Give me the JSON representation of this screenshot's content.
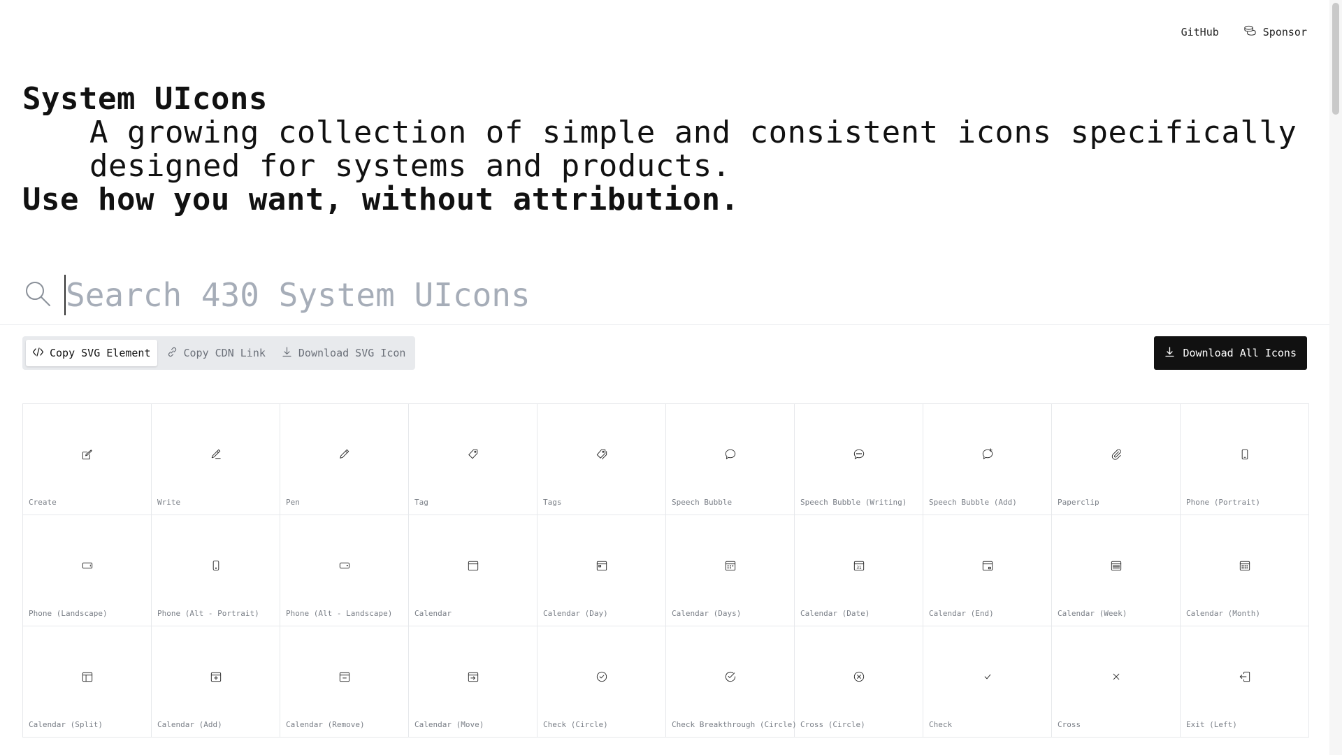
{
  "nav": {
    "github": "GitHub",
    "sponsor": "Sponsor",
    "sponsor_icon": "coins-icon"
  },
  "hero": {
    "title": "System UIcons",
    "subtitle": "A growing collection of simple and consistent icons specifically designed for systems and products.",
    "usage": "Use how you want, without attribution."
  },
  "search": {
    "placeholder": "Search 430 System UIcons",
    "value": ""
  },
  "toolbar": {
    "copy_svg": "Copy SVG Element",
    "copy_cdn": "Copy CDN Link",
    "download_svg": "Download SVG Icon",
    "active": "copy_svg"
  },
  "download_all": "Download All Icons",
  "icons": [
    {
      "label": "Create",
      "icon": "create-icon"
    },
    {
      "label": "Write",
      "icon": "write-icon"
    },
    {
      "label": "Pen",
      "icon": "pen-icon"
    },
    {
      "label": "Tag",
      "icon": "tag-icon"
    },
    {
      "label": "Tags",
      "icon": "tags-icon"
    },
    {
      "label": "Speech Bubble",
      "icon": "speech-bubble-icon"
    },
    {
      "label": "Speech Bubble (Writing)",
      "icon": "speech-bubble-writing-icon"
    },
    {
      "label": "Speech Bubble (Add)",
      "icon": "speech-bubble-add-icon"
    },
    {
      "label": "Paperclip",
      "icon": "paperclip-icon"
    },
    {
      "label": "Phone (Portrait)",
      "icon": "phone-portrait-icon"
    },
    {
      "label": "Phone (Landscape)",
      "icon": "phone-landscape-icon"
    },
    {
      "label": "Phone (Alt - Portrait)",
      "icon": "phone-alt-portrait-icon"
    },
    {
      "label": "Phone (Alt - Landscape)",
      "icon": "phone-alt-landscape-icon"
    },
    {
      "label": "Calendar",
      "icon": "calendar-icon"
    },
    {
      "label": "Calendar (Day)",
      "icon": "calendar-day-icon"
    },
    {
      "label": "Calendar (Days)",
      "icon": "calendar-days-icon"
    },
    {
      "label": "Calendar (Date)",
      "icon": "calendar-date-icon",
      "glyph": "31"
    },
    {
      "label": "Calendar (End)",
      "icon": "calendar-end-icon"
    },
    {
      "label": "Calendar (Week)",
      "icon": "calendar-week-icon"
    },
    {
      "label": "Calendar (Month)",
      "icon": "calendar-month-icon"
    },
    {
      "label": "Calendar (Split)",
      "icon": "calendar-split-icon"
    },
    {
      "label": "Calendar (Add)",
      "icon": "calendar-add-icon"
    },
    {
      "label": "Calendar (Remove)",
      "icon": "calendar-remove-icon"
    },
    {
      "label": "Calendar (Move)",
      "icon": "calendar-move-icon"
    },
    {
      "label": "Check (Circle)",
      "icon": "check-circle-icon"
    },
    {
      "label": "Check Breakthrough (Circle)",
      "icon": "check-breakthrough-circle-icon"
    },
    {
      "label": "Cross (Circle)",
      "icon": "cross-circle-icon"
    },
    {
      "label": "Check",
      "icon": "check-icon"
    },
    {
      "label": "Cross",
      "icon": "cross-icon"
    },
    {
      "label": "Exit (Left)",
      "icon": "exit-left-icon"
    }
  ]
}
